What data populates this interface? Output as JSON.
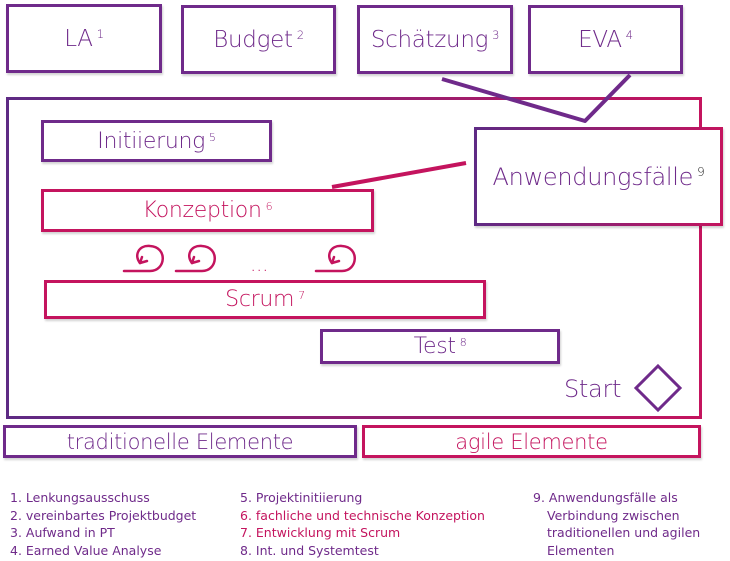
{
  "colors": {
    "traditional": "#6f2a8a",
    "agile": "#c4145e"
  },
  "top_boxes": [
    {
      "label": "LA",
      "note": "1"
    },
    {
      "label": "Budget",
      "note": "2"
    },
    {
      "label": "Schätzung",
      "note": "3"
    },
    {
      "label": "EVA",
      "note": "4"
    }
  ],
  "phases": {
    "initiierung": {
      "label": "Initiierung",
      "note": "5"
    },
    "konzeption": {
      "label": "Konzeption",
      "note": "6"
    },
    "sprints_ellipsis": "...",
    "scrum": {
      "label": "Scrum",
      "note": "7"
    },
    "test": {
      "label": "Test",
      "note": "8"
    },
    "anwendungsfaelle": {
      "label": "Anwendungsfälle",
      "note": "9"
    },
    "start": {
      "label": "Start"
    }
  },
  "categories": {
    "traditional": "traditionelle Elemente",
    "agile": "agile Elemente"
  },
  "legend": {
    "col1": [
      "1. Lenkungsausschuss",
      "2. vereinbartes Projektbudget",
      "3. Aufwand in PT",
      "4. Earned Value Analyse"
    ],
    "col2": [
      "5. Projektinitiierung",
      "6. fachliche und technische Konzeption",
      "7. Entwicklung mit Scrum",
      "8. Int. und Systemtest"
    ],
    "col3": [
      "9. Anwendungsfälle als",
      "Verbindung zwischen",
      "traditionellen und agilen",
      "Elementen"
    ]
  }
}
